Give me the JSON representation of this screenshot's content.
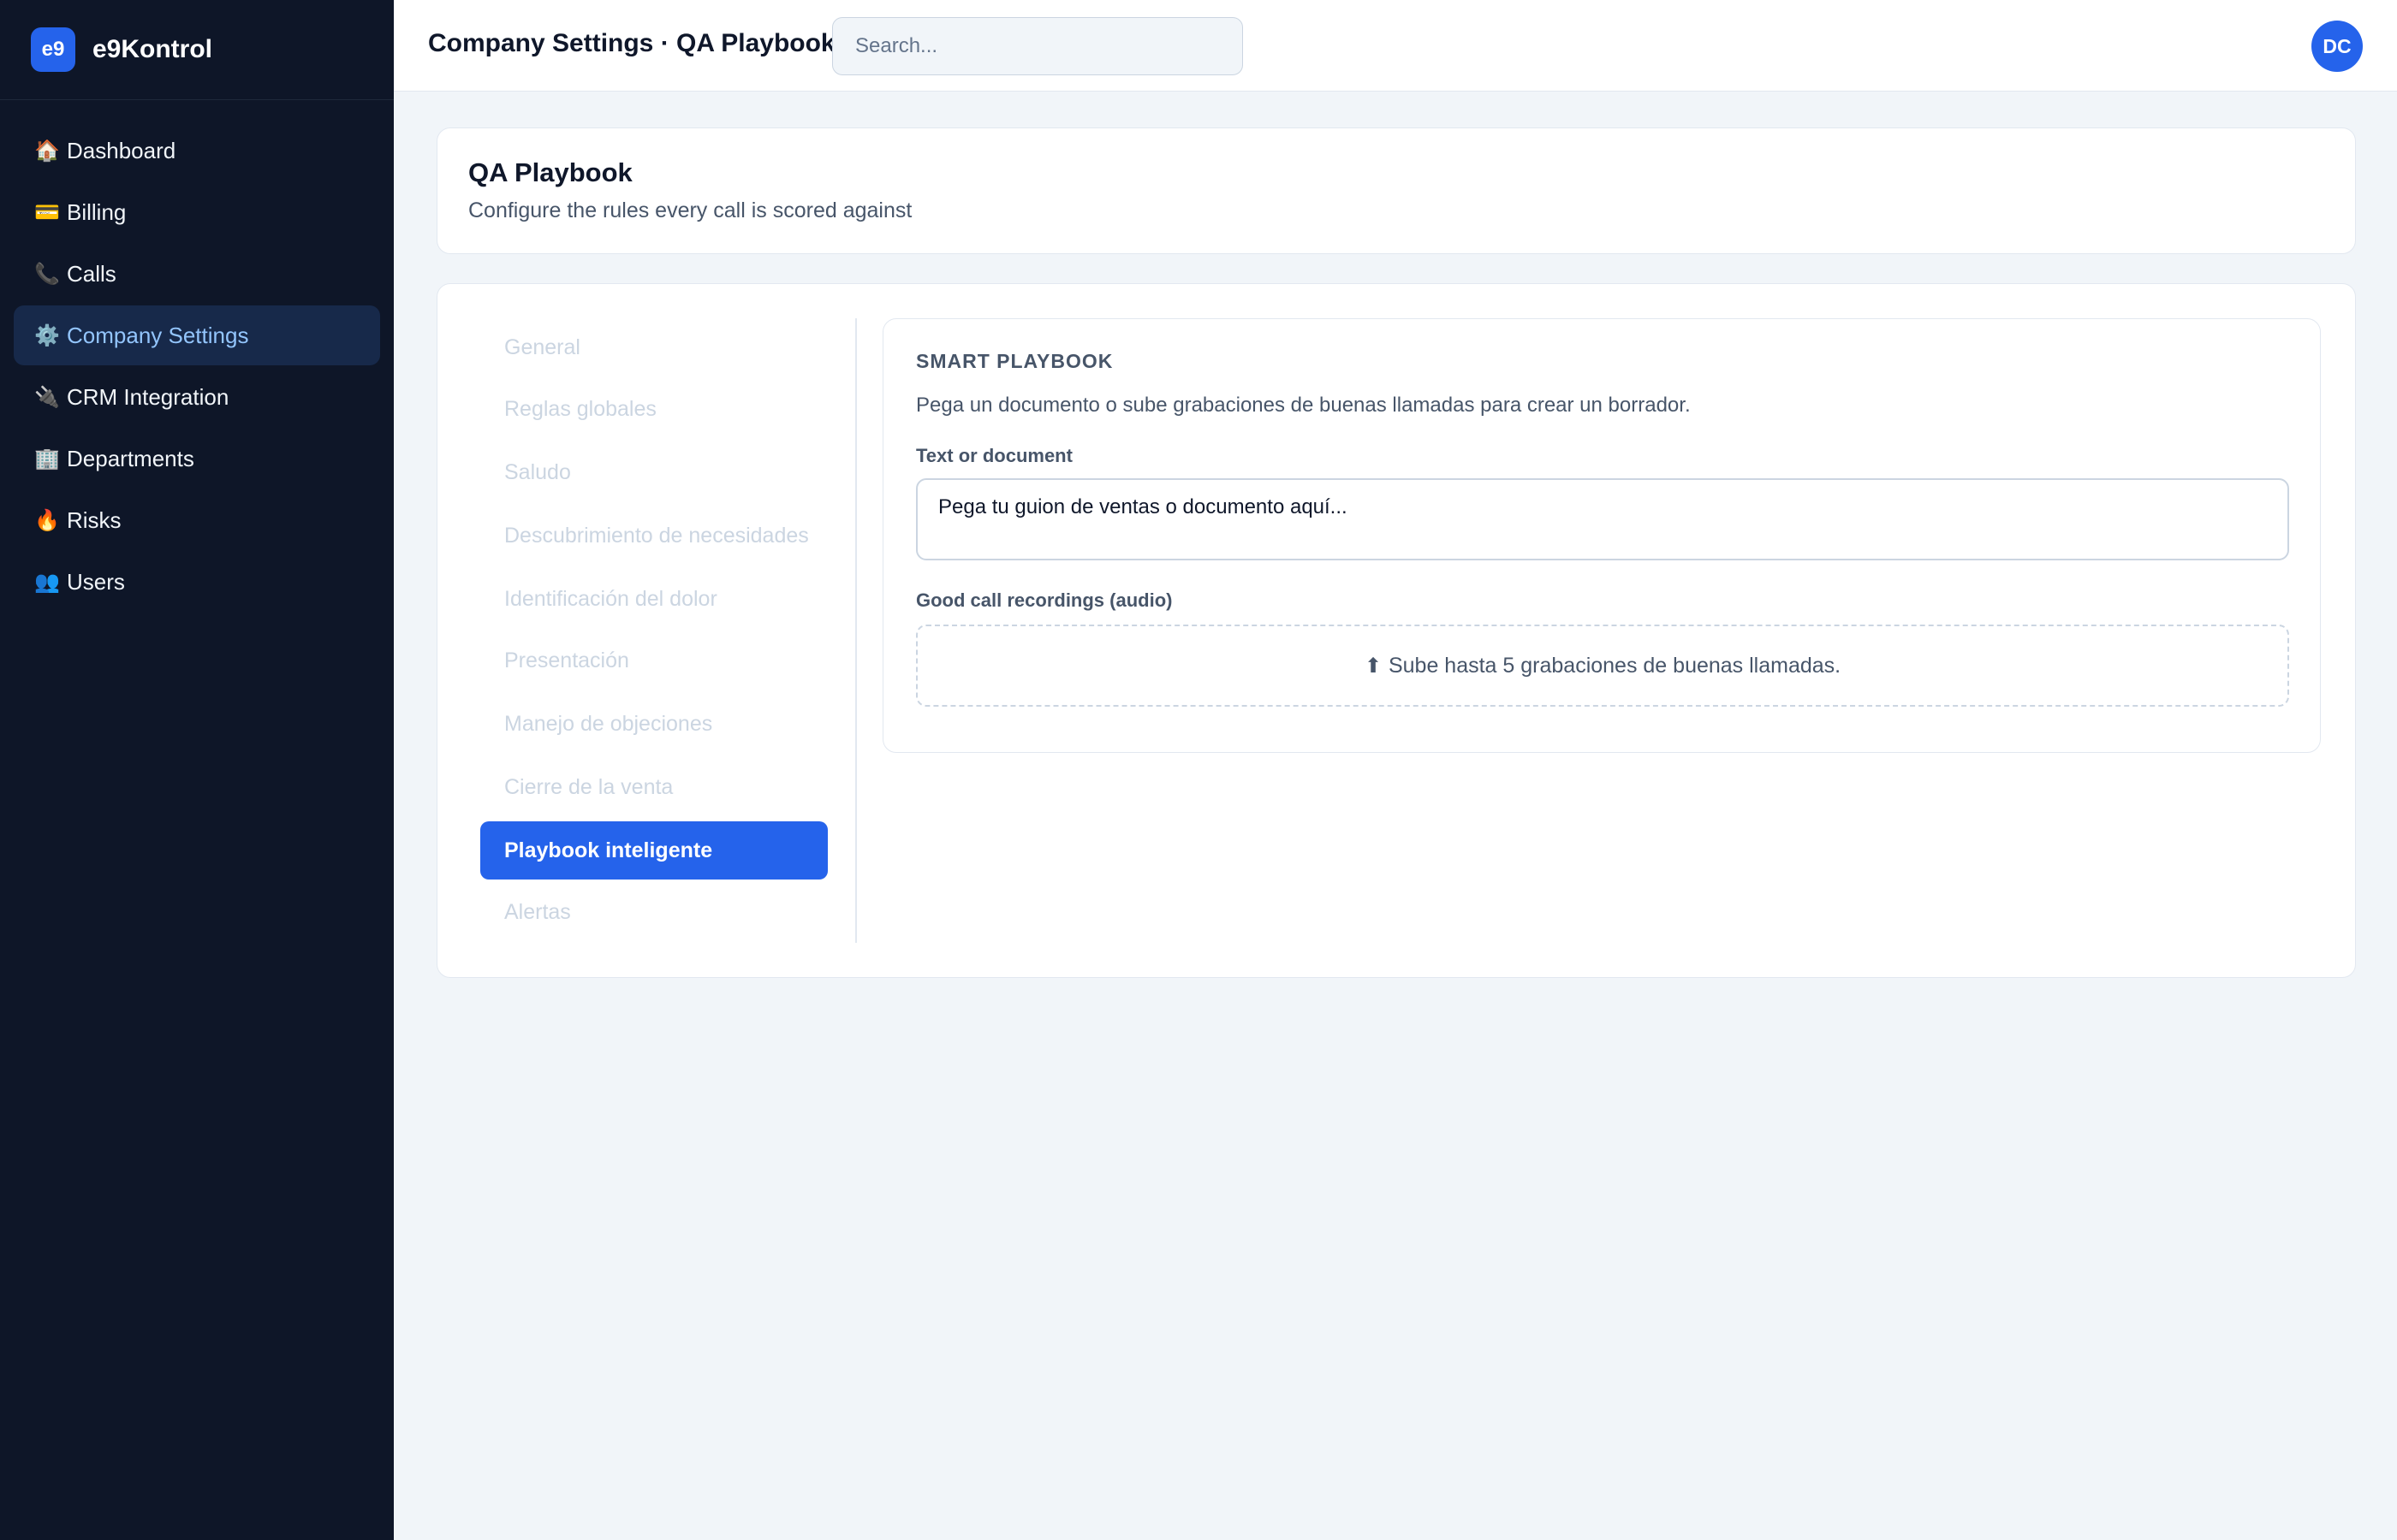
{
  "brand": {
    "logo_text": "e9",
    "name": "e9Kontrol"
  },
  "sidebar": {
    "items": [
      {
        "icon": "🏠",
        "icon_name": "house-icon",
        "label": "Dashboard",
        "active": false
      },
      {
        "icon": "💳",
        "icon_name": "credit-card-icon",
        "label": "Billing",
        "active": false
      },
      {
        "icon": "📞",
        "icon_name": "phone-icon",
        "label": "Calls",
        "active": false
      },
      {
        "icon": "⚙️",
        "icon_name": "gear-icon",
        "label": "Company Settings",
        "active": true
      },
      {
        "icon": "🔌",
        "icon_name": "plug-icon",
        "label": "CRM Integration",
        "active": false
      },
      {
        "icon": "🏢",
        "icon_name": "office-building-icon",
        "label": "Departments",
        "active": false
      },
      {
        "icon": "🔥",
        "icon_name": "fire-icon",
        "label": "Risks",
        "active": false
      },
      {
        "icon": "👥",
        "icon_name": "users-icon",
        "label": "Users",
        "active": false
      }
    ]
  },
  "topbar": {
    "title": "Company Settings · QA Playbook",
    "search_placeholder": "Search...",
    "avatar_initials": "DC"
  },
  "header": {
    "title": "QA Playbook",
    "subtitle": "Configure the rules every call is scored against"
  },
  "subnav": {
    "items": [
      {
        "label": "General",
        "active": false
      },
      {
        "label": "Reglas globales",
        "active": false
      },
      {
        "label": "Saludo",
        "active": false
      },
      {
        "label": "Descubrimiento de necesidades",
        "active": false
      },
      {
        "label": "Identificación del dolor",
        "active": false
      },
      {
        "label": "Presentación",
        "active": false
      },
      {
        "label": "Manejo de objeciones",
        "active": false
      },
      {
        "label": "Cierre de la venta",
        "active": false
      },
      {
        "label": "Playbook inteligente",
        "active": true
      },
      {
        "label": "Alertas",
        "active": false
      }
    ]
  },
  "panel": {
    "title": "SMART PLAYBOOK",
    "description": "Pega un documento o sube grabaciones de buenas llamadas para crear un borrador.",
    "text_label": "Text or document",
    "text_placeholder": "Pega tu guion de ventas o documento aquí...",
    "recordings_label": "Good call recordings (audio)",
    "upload_icon": "⬆",
    "upload_text": "Sube hasta 5 grabaciones de buenas llamadas."
  },
  "colors": {
    "sidebar_bg": "#0e1628",
    "accent": "#2563eb",
    "active_nav_bg": "#17294a",
    "active_nav_text": "#93c5fd",
    "page_bg": "#f1f5f9"
  }
}
